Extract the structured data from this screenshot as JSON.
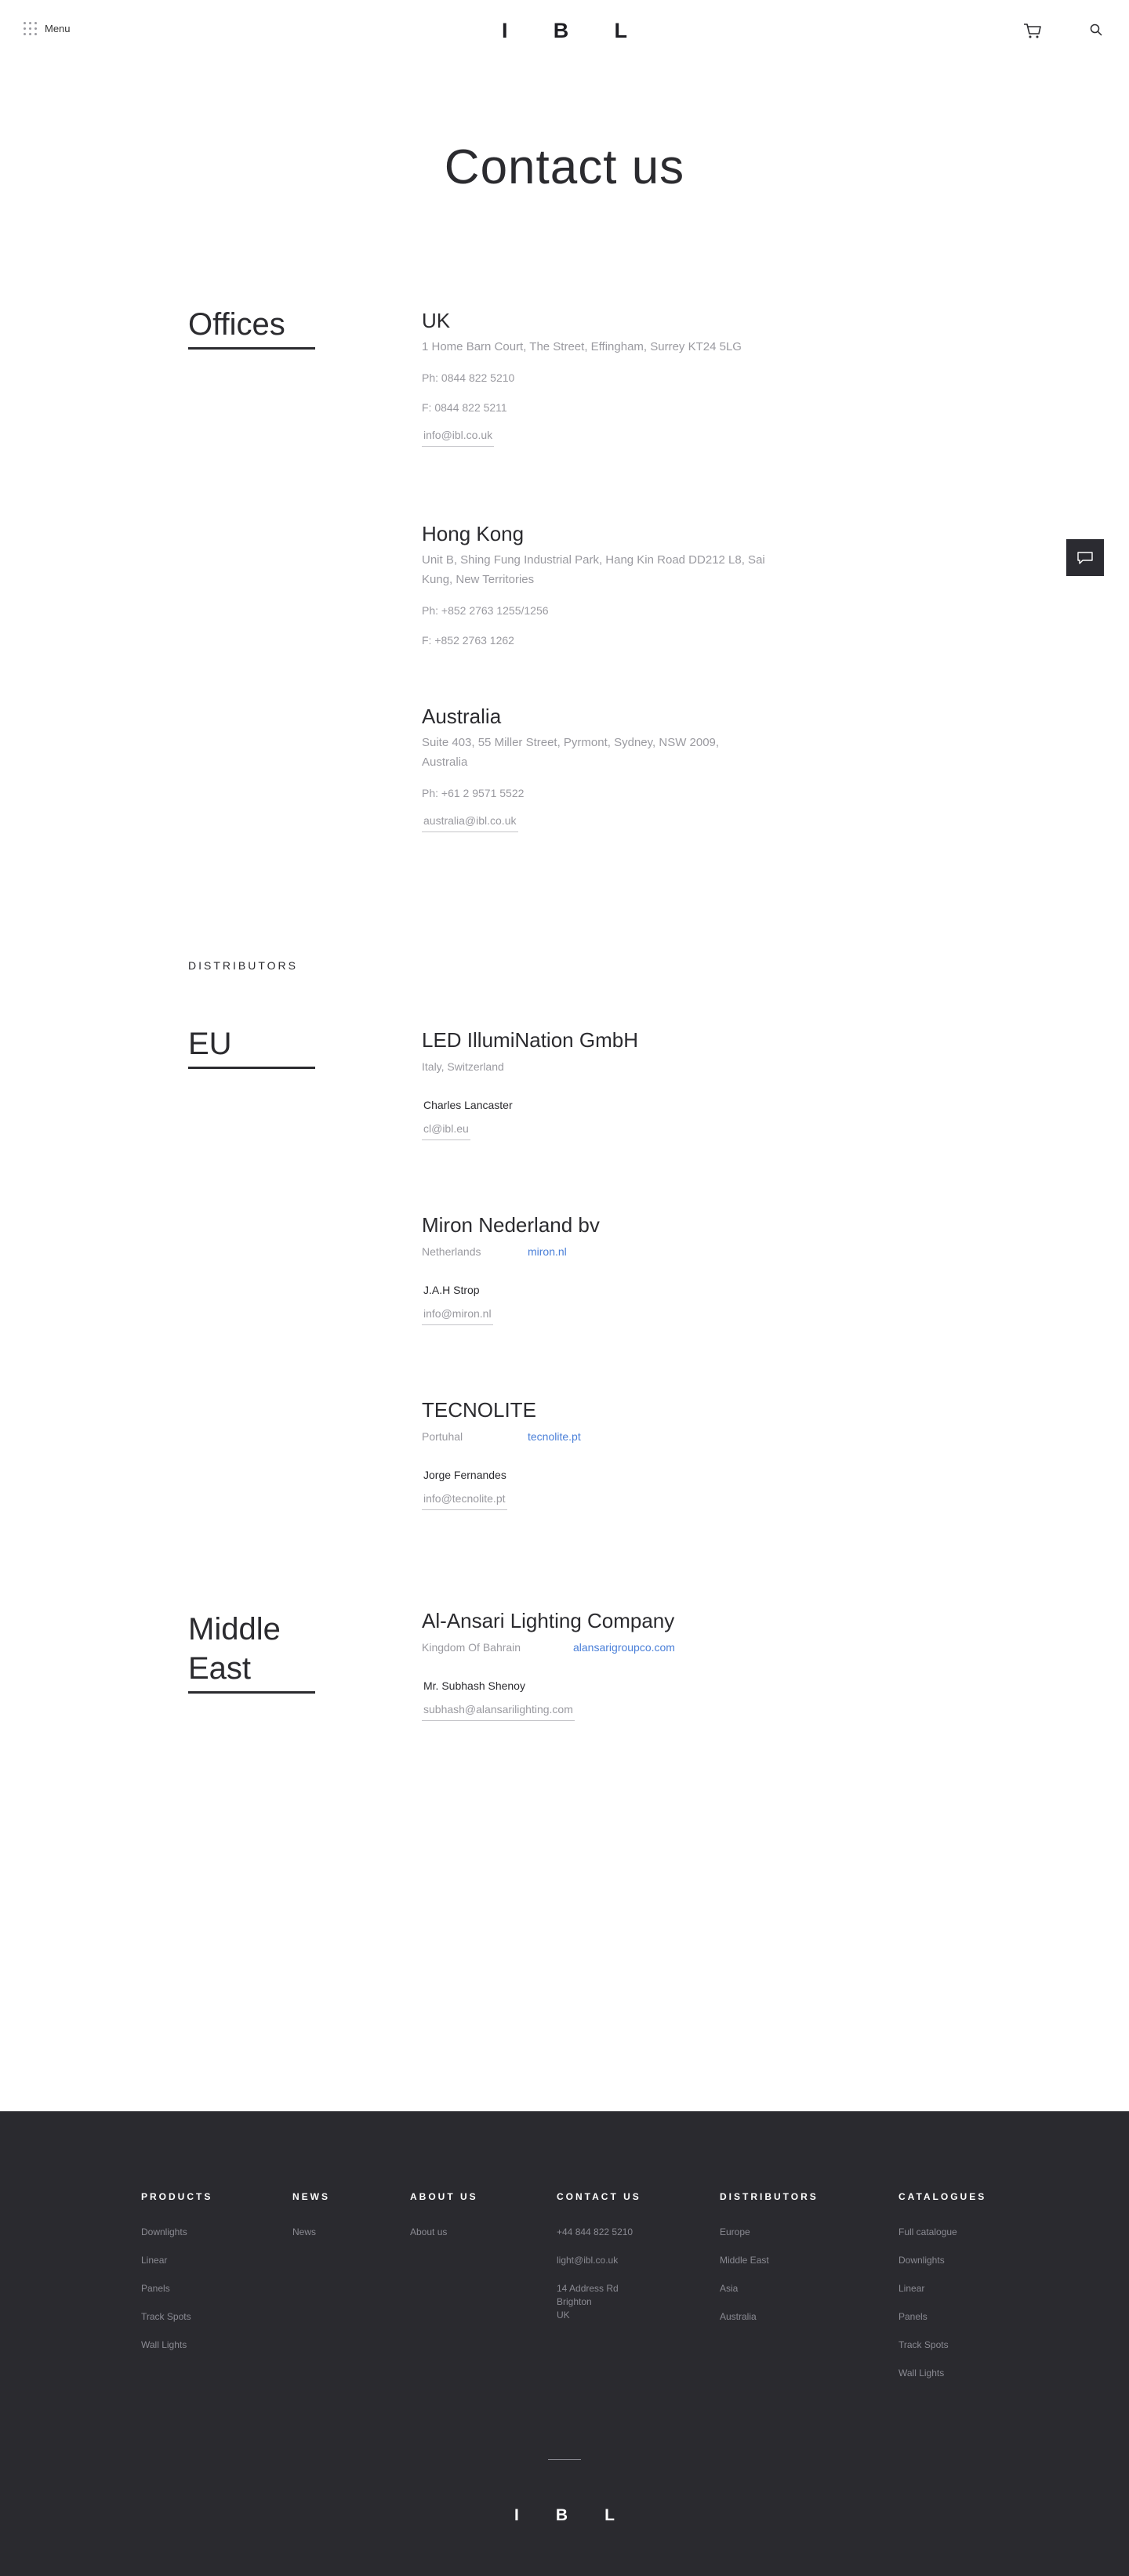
{
  "header": {
    "menu_label": "Menu",
    "logo": [
      "I",
      "B",
      "L"
    ],
    "icons": [
      "cart-icon",
      "search-icon"
    ]
  },
  "page_title": "Contact us",
  "offices": {
    "heading": "Offices",
    "items": [
      {
        "name": "UK",
        "address": "1 Home Barn Court, The Street, Effingham, Surrey KT24 5LG",
        "phone": "Ph: 0844 822 5210",
        "fax": "F: 0844 822 5211",
        "email": "info@ibl.co.uk"
      },
      {
        "name": "Hong Kong",
        "address": "Unit B, Shing Fung Industrial Park, Hang Kin Road DD212 L8, Sai Kung, New Territories",
        "phone": "Ph: +852 2763 1255/1256",
        "fax": "F: +852 2763 1262"
      },
      {
        "name": "Australia",
        "address": "Suite 403, 55 Miller Street, Pyrmont, Sydney, NSW 2009, Australia",
        "phone": "Ph: +61 2 9571 5522",
        "email": "australia@ibl.co.uk"
      }
    ]
  },
  "distributors_label": "DISTRIBUTORS",
  "regions": [
    {
      "heading": "EU",
      "items": [
        {
          "company": "LED IllumiNation GmbH",
          "country": "Italy, Switzerland",
          "website": "",
          "contact": "Charles Lancaster",
          "email": "cl@ibl.eu"
        },
        {
          "company": "Miron Nederland bv",
          "country": "Netherlands",
          "website": "miron.nl",
          "contact": "J.A.H Strop",
          "email": "info@miron.nl"
        },
        {
          "company": "TECNOLITE",
          "country": "Portuhal",
          "website": "tecnolite.pt",
          "contact": "Jorge Fernandes",
          "email": "info@tecnolite.pt"
        }
      ]
    },
    {
      "heading_lines": [
        "Middle",
        "East"
      ],
      "items": [
        {
          "company": "Al-Ansari Lighting Company",
          "country": "Kingdom Of Bahrain",
          "website": "alansarigroupco.com",
          "contact": "Mr. Subhash Shenoy",
          "email": "subhash@alansarilighting.com"
        }
      ]
    }
  ],
  "footer": {
    "columns": [
      {
        "title": "PRODUCTS",
        "items": [
          "Downlights",
          "Linear",
          "Panels",
          "Track Spots",
          "Wall Lights"
        ]
      },
      {
        "title": "NEWS",
        "items": [
          "News"
        ]
      },
      {
        "title": "ABOUT US",
        "items": [
          "About us"
        ]
      },
      {
        "title": "CONTACT US",
        "items": [
          "+44 844 822 5210",
          "light@ibl.co.uk",
          "14 Address Rd\nBrighton\nUK"
        ]
      },
      {
        "title": "DISTRIBUTORS",
        "items": [
          "Europe",
          "Middle East",
          "Asia",
          "Australia"
        ]
      },
      {
        "title": "CATALOGUES",
        "items": [
          "Full catalogue",
          "Downlights",
          "Linear",
          "Panels",
          "Track Spots",
          "Wall Lights"
        ]
      }
    ],
    "logo": [
      "I",
      "B",
      "L"
    ]
  },
  "colors": {
    "footer_bg": "#2a2a2f",
    "link": "#4a7fd8",
    "muted": "#9a9aa0",
    "text": "#2b2b2f"
  }
}
